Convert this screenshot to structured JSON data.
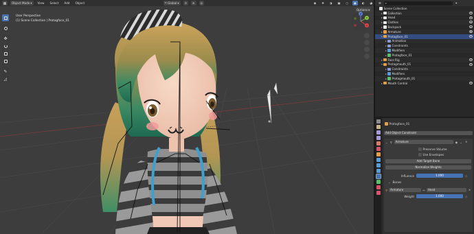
{
  "viewport": {
    "header": {
      "mode_label": "Object Mode",
      "menus": [
        "View",
        "Select",
        "Add",
        "Object"
      ],
      "transform_orientation": "Global",
      "options_label": "Options"
    },
    "overlay": {
      "view_name": "User Perspective",
      "context": "(1) Scene Collection | Protagface_01"
    },
    "tools": [
      "select-box-icon",
      "cursor-icon",
      "move-icon",
      "rotate-icon",
      "scale-icon",
      "transform-icon",
      "annotate-icon",
      "measure-icon"
    ],
    "gizmo_axes": [
      "Z",
      "Y",
      "X"
    ]
  },
  "outliner": {
    "rows": [
      {
        "label": "Scene Collection",
        "indent": 0,
        "icon": "collection",
        "expander": ""
      },
      {
        "label": "Collection",
        "indent": 1,
        "icon": "collection",
        "expander": ">"
      },
      {
        "label": "Head",
        "indent": 1,
        "icon": "collection",
        "expander": ">"
      },
      {
        "label": "Clothes",
        "indent": 1,
        "icon": "collection",
        "expander": ">"
      },
      {
        "label": "Backpack",
        "indent": 1,
        "icon": "collection",
        "expander": ">"
      },
      {
        "label": "Armature",
        "indent": 1,
        "icon": "armature",
        "expander": ">"
      },
      {
        "label": "Protagface_01",
        "indent": 1,
        "icon": "mesh",
        "expander": "v",
        "selected": true
      },
      {
        "label": "Animation",
        "indent": 2,
        "icon": "animation",
        "expander": ">"
      },
      {
        "label": "Constraints",
        "indent": 2,
        "icon": "constraint",
        "expander": ">"
      },
      {
        "label": "Modifiers",
        "indent": 2,
        "icon": "modifier",
        "expander": ">"
      },
      {
        "label": "Protagface_01",
        "indent": 2,
        "icon": "mesh-data",
        "expander": ">"
      },
      {
        "label": "Face Rig",
        "indent": 1,
        "icon": "armature",
        "expander": ">"
      },
      {
        "label": "Protagmouth_01",
        "indent": 1,
        "icon": "mesh",
        "expander": "v"
      },
      {
        "label": "Constraints",
        "indent": 2,
        "icon": "constraint",
        "expander": ">"
      },
      {
        "label": "Modifiers",
        "indent": 2,
        "icon": "modifier",
        "expander": ">"
      },
      {
        "label": "Protagmouth_01",
        "indent": 2,
        "icon": "mesh-data",
        "expander": ">"
      },
      {
        "label": "Mouth Control",
        "indent": 1,
        "icon": "armature",
        "expander": ">"
      }
    ]
  },
  "properties": {
    "object_name": "Protagface_01",
    "add_constraint_label": "Add Object Constraint",
    "constraint_name": "Armature",
    "preserve_volume_label": "Preserve Volume",
    "use_envelopes_label": "Use Envelopes",
    "add_target_bone_label": "Add Target Bone",
    "normalize_weights_label": "Normalize Weights",
    "influence_label": "Influence",
    "influence_value": "1.000",
    "influence_fraction": 1.0,
    "bones_label": "Bones",
    "bone_target": "Armature",
    "bone_name": "Head",
    "weight_label": "Weight",
    "weight_value": "1.000",
    "weight_fraction": 1.0
  },
  "colors": {
    "accent": "#4772b3",
    "selected_row": "#334d80",
    "collection_icon": "#e6e6e6",
    "armature_icon": "#e39f4a",
    "mesh_icon": "#e39f4a",
    "data_icon": "#5bbf6a",
    "constraint_icon": "#8c9bd6",
    "modifier_icon": "#5a9bd8"
  }
}
